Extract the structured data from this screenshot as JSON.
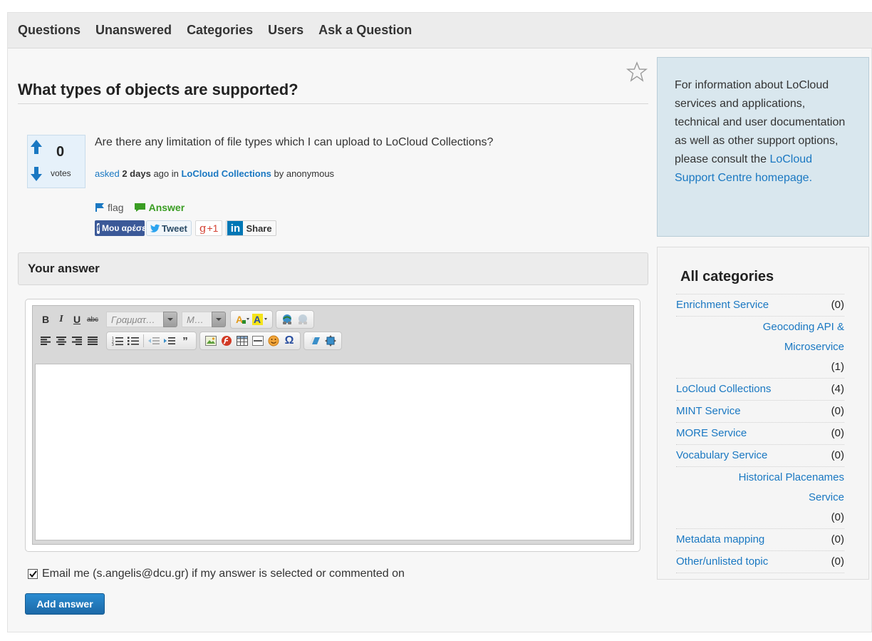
{
  "nav": {
    "items": [
      "Questions",
      "Unanswered",
      "Categories",
      "Users",
      "Ask a Question"
    ]
  },
  "question": {
    "title": "What types of objects are supported?",
    "votes": "0",
    "votes_label": "votes",
    "body": "Are there any limitation of file types which I can upload to LoCloud Collections?",
    "meta": {
      "asked_label": "asked",
      "when": "2 days",
      "ago": "ago in",
      "category": "LoCloud Collections",
      "by": "by anonymous"
    },
    "actions": {
      "flag": "flag",
      "answer": "Answer"
    },
    "share": {
      "facebook": "Μου αρέσει",
      "tweet": "Tweet",
      "gplus": "+1",
      "linkedin": "Share"
    }
  },
  "answer_form": {
    "header": "Your answer",
    "toolbar": {
      "font_placeholder": "Γραμματ…",
      "size_placeholder": "Μ…"
    },
    "notify_text": "Email me (s.angelis@dcu.gr) if my answer is selected or commented on",
    "notify_checked": true,
    "submit": "Add answer"
  },
  "sidebar": {
    "info": {
      "text": "For information about LoCloud services and applications, technical and user documentation as well as other support options, please consult the",
      "link": "LoCloud Support Centre homepage."
    },
    "categories_title": "All categories",
    "categories": [
      {
        "name": "Enrichment Service",
        "count": "(0)",
        "wrap": false
      },
      {
        "name": "Geocoding API & Microservice",
        "count": "(1)",
        "wrap": true
      },
      {
        "name": "LoCloud Collections",
        "count": "(4)",
        "wrap": false
      },
      {
        "name": "MINT Service",
        "count": "(0)",
        "wrap": false
      },
      {
        "name": "MORE Service",
        "count": "(0)",
        "wrap": false
      },
      {
        "name": "Vocabulary Service",
        "count": "(0)",
        "wrap": false
      },
      {
        "name": "Historical Placenames Service",
        "count": "(0)",
        "wrap": true
      },
      {
        "name": "Metadata mapping",
        "count": "(0)",
        "wrap": false
      },
      {
        "name": "Other/unlisted topic",
        "count": "(0)",
        "wrap": false
      }
    ]
  },
  "colors": {
    "link": "#1a78c2",
    "accent_button": "#1c69a8",
    "answer_green": "#3a9d23",
    "info_bg": "#d9e7ee"
  }
}
